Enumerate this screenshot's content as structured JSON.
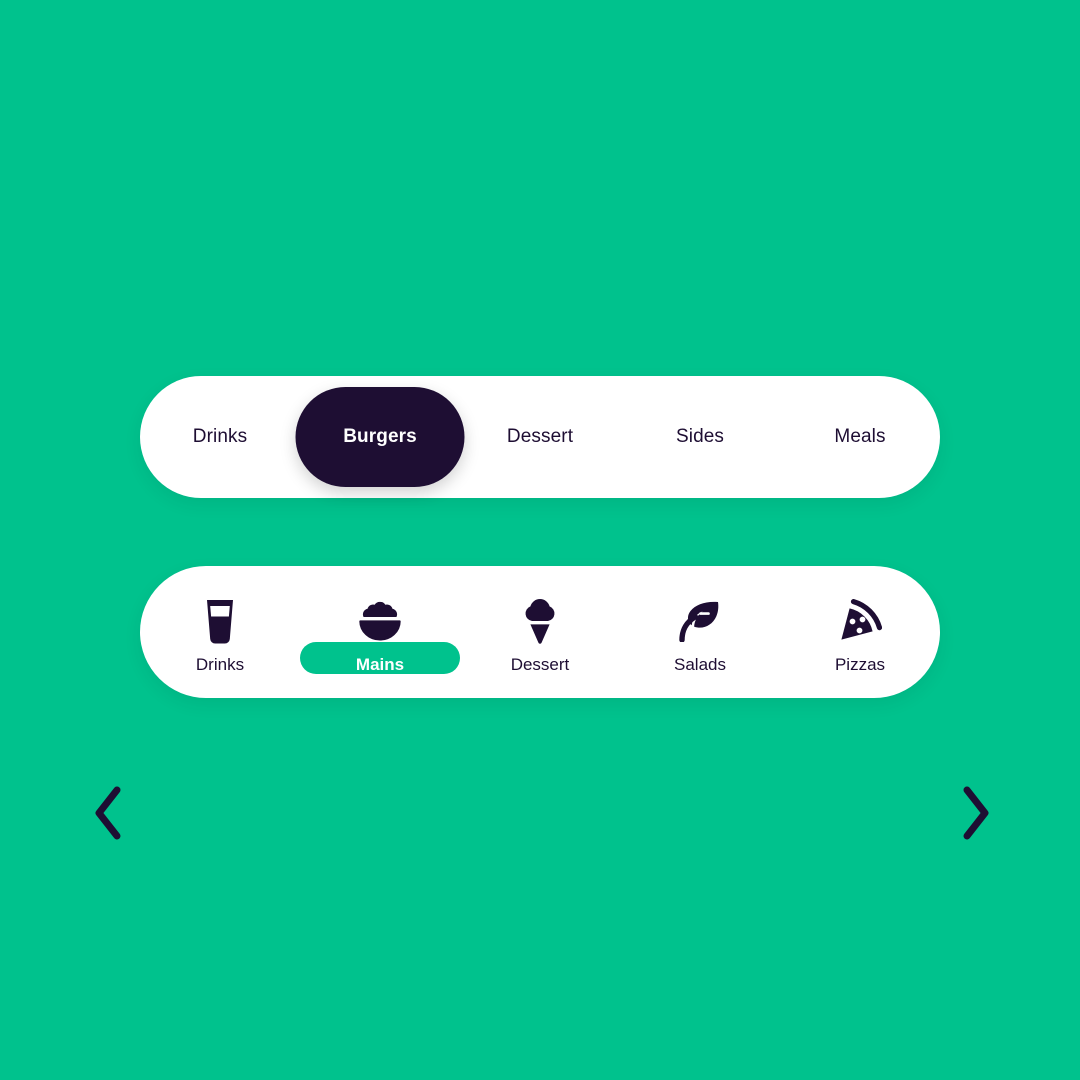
{
  "theme": {
    "background": "#00c28d",
    "bar_surface": "#ffffff",
    "dark_accent": "#1e0e33",
    "green_accent": "#00c28d",
    "text_on_dark": "#ffffff"
  },
  "category_bar": {
    "prev_arrow_icon": "chevron-left-icon",
    "next_arrow_icon": "chevron-right-icon",
    "items": [
      {
        "label": "Drinks",
        "active": false
      },
      {
        "label": "Burgers",
        "active": true
      },
      {
        "label": "Dessert",
        "active": false
      },
      {
        "label": "Sides",
        "active": false
      },
      {
        "label": "Meals",
        "active": false
      }
    ]
  },
  "icon_bar": {
    "items": [
      {
        "label": "Drinks",
        "icon": "drink-glass-icon",
        "active": false
      },
      {
        "label": "Mains",
        "icon": "rice-bowl-icon",
        "active": true
      },
      {
        "label": "Dessert",
        "icon": "ice-cream-icon",
        "active": false
      },
      {
        "label": "Salads",
        "icon": "leaf-icon",
        "active": false
      },
      {
        "label": "Pizzas",
        "icon": "pizza-slice-icon",
        "active": false
      }
    ]
  }
}
